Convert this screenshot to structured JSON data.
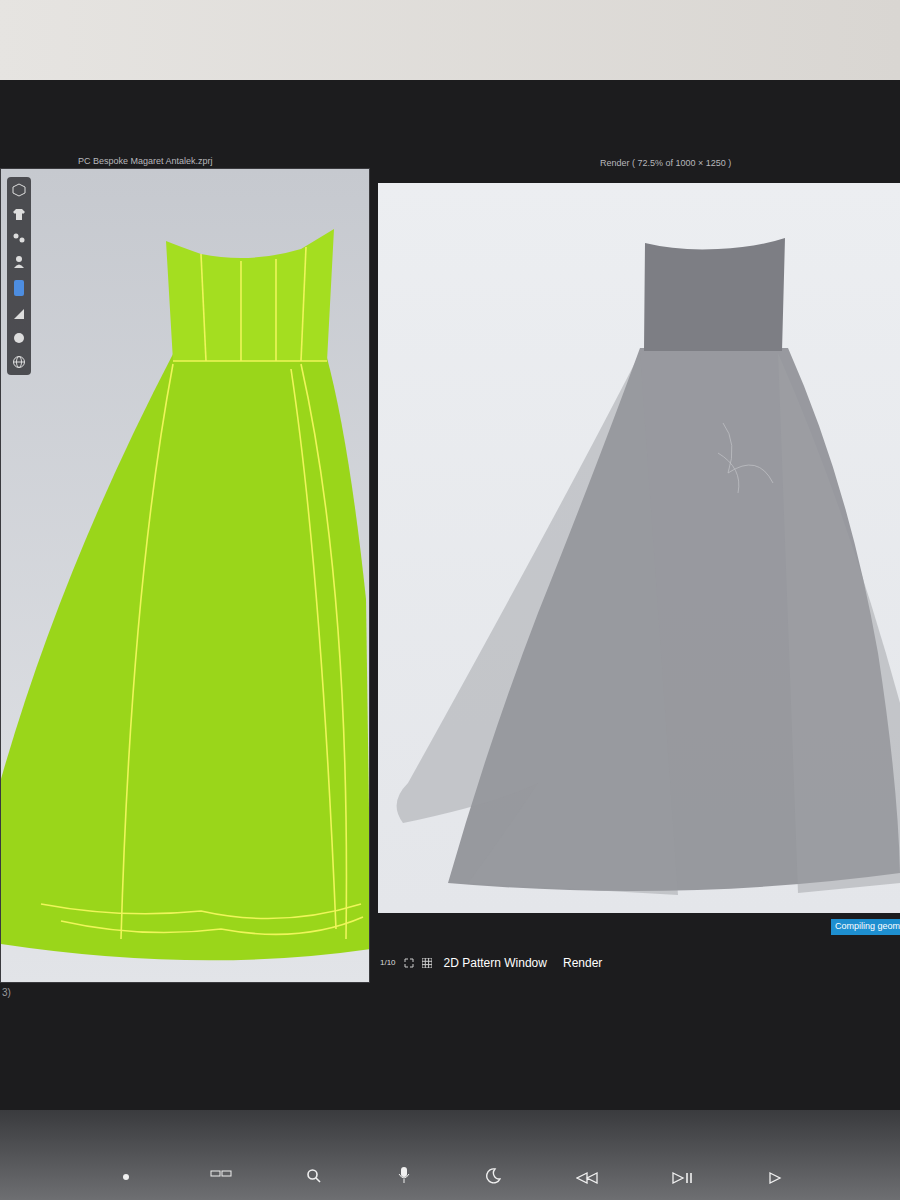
{
  "viewport": {
    "title": "PC Bespoke Magaret Antalek.zprj"
  },
  "render": {
    "title": "Render ( 72.5% of 1000 × 1250 )"
  },
  "status": {
    "badge": "Compiling geom"
  },
  "zoom_controls": [
    "1/10"
  ],
  "bottom_tabs": [
    "2D Pattern Window",
    "Render"
  ],
  "corner": "3)"
}
